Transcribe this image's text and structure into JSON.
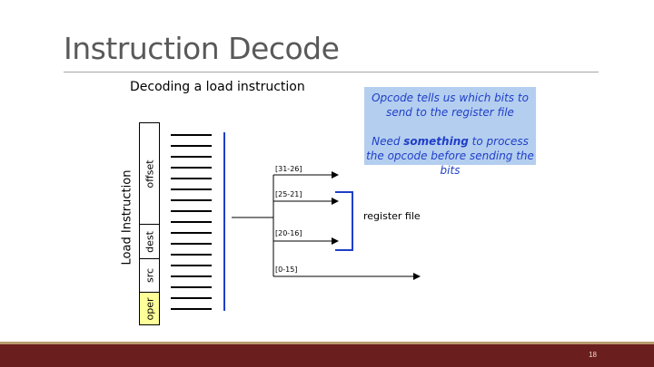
{
  "slide": {
    "title": "Instruction Decode",
    "subtitle": "Decoding a load instruction",
    "page_number": "18"
  },
  "callout": {
    "line1": "Opcode tells us which bits to send to the register file",
    "line2_pre": "Need ",
    "line2_bold": "something",
    "line2_post": " to process the opcode before sending the bits"
  },
  "instruction": {
    "label": "Load Instruction",
    "fields": [
      "offset",
      "dest",
      "src",
      "oper"
    ]
  },
  "bit_ranges": [
    "[31-26]",
    "[25-21]",
    "[20-16]",
    "[0-15]"
  ],
  "register_file_label": "register file",
  "colors": {
    "oper_fill": "#ffff99",
    "bus_line": "#1f3fc7",
    "callout_bg": "#b4cef0",
    "footer": "#6b1e1e"
  }
}
